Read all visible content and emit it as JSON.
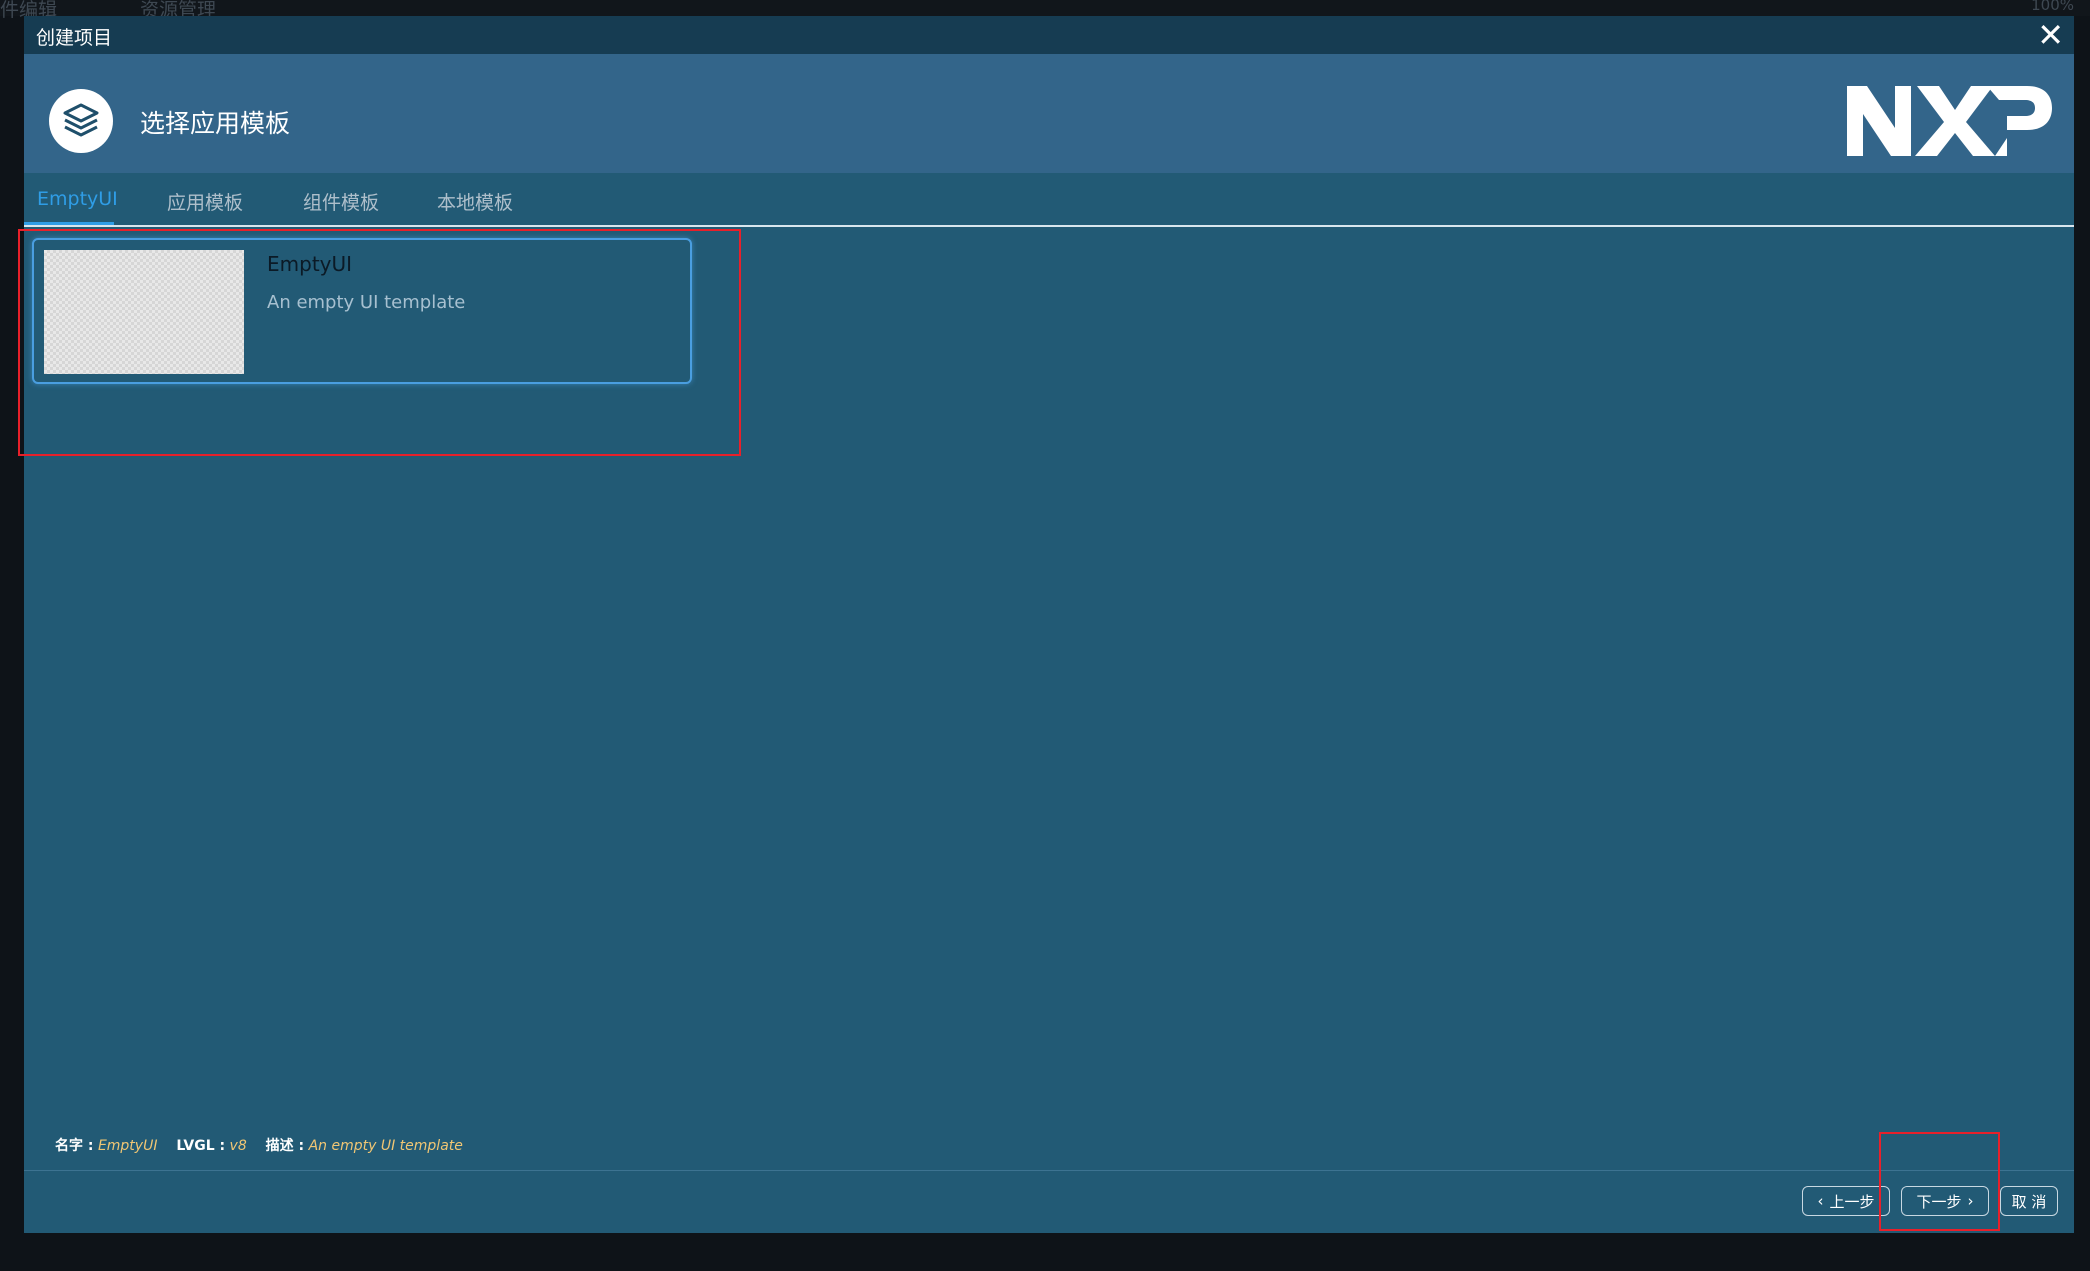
{
  "background": {
    "tabs": [
      "件编辑",
      "资源管理"
    ],
    "zoom": "100%"
  },
  "dialog": {
    "title": "创建项目",
    "heading": "选择应用模板",
    "brand": "NXP",
    "tabs": [
      {
        "label": "EmptyUI",
        "active": true
      },
      {
        "label": "应用模板",
        "active": false
      },
      {
        "label": "组件模板",
        "active": false
      },
      {
        "label": "本地模板",
        "active": false
      }
    ],
    "template": {
      "name": "EmptyUI",
      "description": "An empty UI template"
    },
    "info": {
      "name_key": "名字 :",
      "name_value": "EmptyUI",
      "lvgl_key": "LVGL :",
      "lvgl_value": "v8",
      "desc_key": "描述 :",
      "desc_value": "An empty UI template"
    },
    "buttons": {
      "prev": "上一步",
      "next": "下一步",
      "cancel": "取 消"
    }
  },
  "colors": {
    "dialog_bg": "#225a75",
    "header_bg": "#33658a",
    "titlebar_bg": "#163c52",
    "accent": "#2f9de6",
    "highlight": "#e8202a"
  },
  "icons": [
    "layers-icon",
    "close-icon",
    "chevron-left-icon",
    "chevron-right-icon"
  ]
}
